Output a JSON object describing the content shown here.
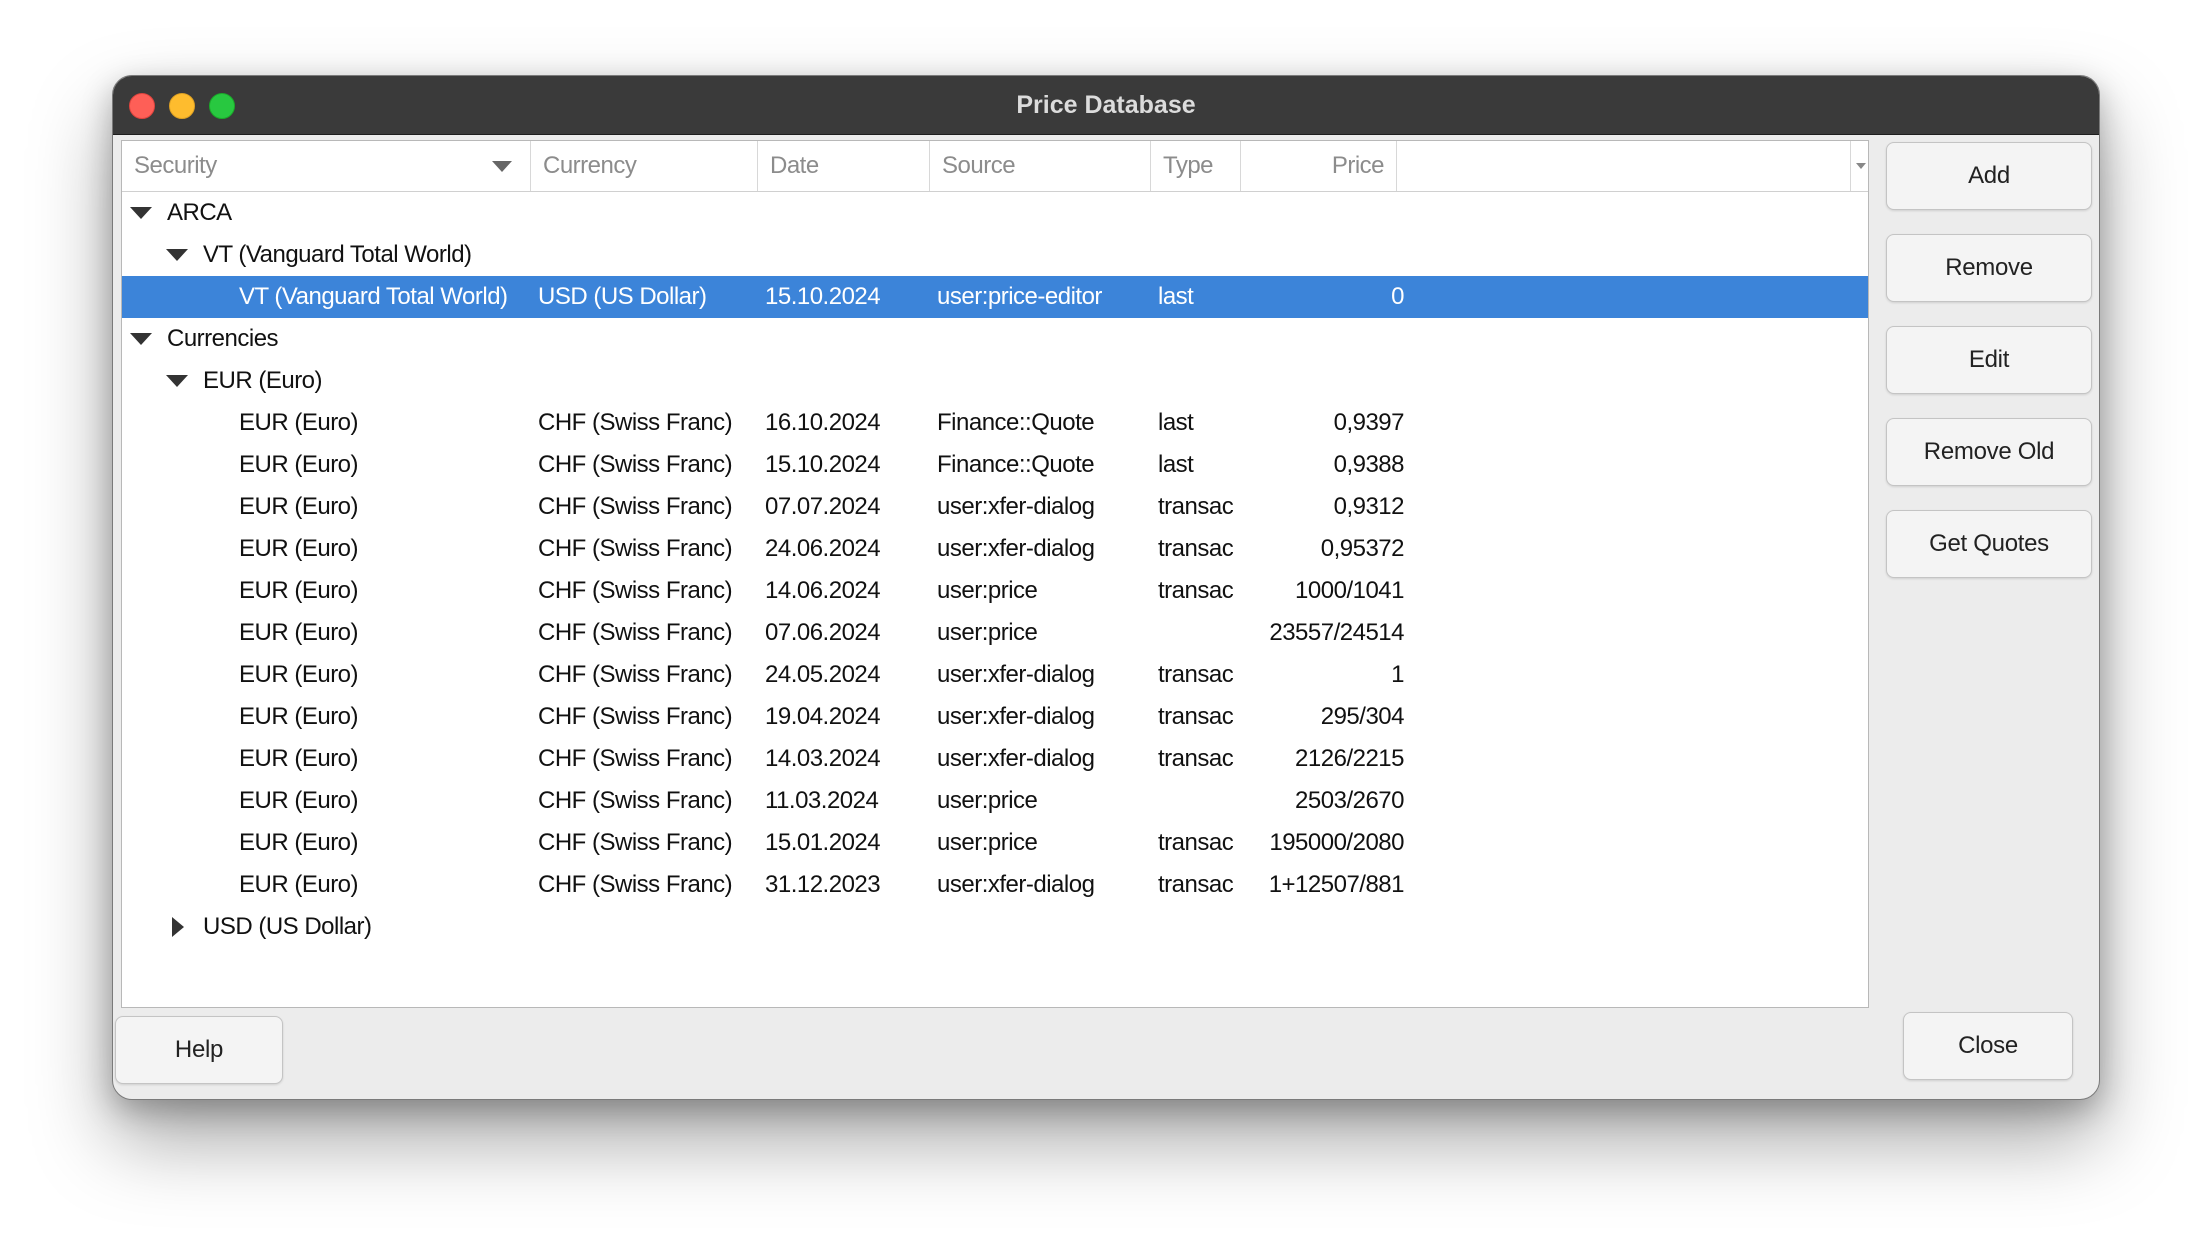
{
  "window": {
    "title": "Price Database"
  },
  "columns": {
    "security": "Security",
    "currency": "Currency",
    "date": "Date",
    "source": "Source",
    "type": "Type",
    "price": "Price"
  },
  "rows": [
    {
      "kind": "group",
      "level": 0,
      "expanded": true,
      "security": "ARCA"
    },
    {
      "kind": "group",
      "level": 1,
      "expanded": true,
      "security": "VT (Vanguard Total World)"
    },
    {
      "kind": "item",
      "level": 2,
      "selected": true,
      "security": "VT (Vanguard Total World)",
      "currency": "USD (US Dollar)",
      "date": "15.10.2024",
      "source": "user:price-editor",
      "type": "last",
      "price": "0"
    },
    {
      "kind": "group",
      "level": 0,
      "expanded": true,
      "security": "Currencies"
    },
    {
      "kind": "group",
      "level": 1,
      "expanded": true,
      "security": "EUR (Euro)"
    },
    {
      "kind": "item",
      "level": 2,
      "security": "EUR (Euro)",
      "currency": "CHF (Swiss Franc)",
      "date": "16.10.2024",
      "source": "Finance::Quote",
      "type": "last",
      "price": "0,9397"
    },
    {
      "kind": "item",
      "level": 2,
      "security": "EUR (Euro)",
      "currency": "CHF (Swiss Franc)",
      "date": "15.10.2024",
      "source": "Finance::Quote",
      "type": "last",
      "price": "0,9388"
    },
    {
      "kind": "item",
      "level": 2,
      "security": "EUR (Euro)",
      "currency": "CHF (Swiss Franc)",
      "date": "07.07.2024",
      "source": "user:xfer-dialog",
      "type": "transac",
      "price": "0,9312"
    },
    {
      "kind": "item",
      "level": 2,
      "security": "EUR (Euro)",
      "currency": "CHF (Swiss Franc)",
      "date": "24.06.2024",
      "source": "user:xfer-dialog",
      "type": "transac",
      "price": "0,95372"
    },
    {
      "kind": "item",
      "level": 2,
      "security": "EUR (Euro)",
      "currency": "CHF (Swiss Franc)",
      "date": "14.06.2024",
      "source": "user:price",
      "type": "transac",
      "price": "1000/1041"
    },
    {
      "kind": "item",
      "level": 2,
      "security": "EUR (Euro)",
      "currency": "CHF (Swiss Franc)",
      "date": "07.06.2024",
      "source": "user:price",
      "type": "",
      "price": "23557/24514"
    },
    {
      "kind": "item",
      "level": 2,
      "security": "EUR (Euro)",
      "currency": "CHF (Swiss Franc)",
      "date": "24.05.2024",
      "source": "user:xfer-dialog",
      "type": "transac",
      "price": "1"
    },
    {
      "kind": "item",
      "level": 2,
      "security": "EUR (Euro)",
      "currency": "CHF (Swiss Franc)",
      "date": "19.04.2024",
      "source": "user:xfer-dialog",
      "type": "transac",
      "price": "295/304"
    },
    {
      "kind": "item",
      "level": 2,
      "security": "EUR (Euro)",
      "currency": "CHF (Swiss Franc)",
      "date": "14.03.2024",
      "source": "user:xfer-dialog",
      "type": "transac",
      "price": "2126/2215"
    },
    {
      "kind": "item",
      "level": 2,
      "security": "EUR (Euro)",
      "currency": "CHF (Swiss Franc)",
      "date": "11.03.2024",
      "source": "user:price",
      "type": "",
      "price": "2503/2670"
    },
    {
      "kind": "item",
      "level": 2,
      "security": "EUR (Euro)",
      "currency": "CHF (Swiss Franc)",
      "date": "15.01.2024",
      "source": "user:price",
      "type": "transac",
      "price": "195000/2080"
    },
    {
      "kind": "item",
      "level": 2,
      "security": "EUR (Euro)",
      "currency": "CHF (Swiss Franc)",
      "date": "31.12.2023",
      "source": "user:xfer-dialog",
      "type": "transac",
      "price": "1+12507/881"
    },
    {
      "kind": "group",
      "level": 1,
      "expanded": false,
      "security": "USD (US Dollar)"
    }
  ],
  "buttons": {
    "add": "Add",
    "remove": "Remove",
    "edit": "Edit",
    "remove_old": "Remove Old",
    "get_quotes": "Get Quotes",
    "help": "Help",
    "close": "Close"
  },
  "colors": {
    "selection": "#3c84d9",
    "titlebar": "#3a3a3a",
    "close_light": "#fe5f57",
    "minimize_light": "#febc2e",
    "zoom_light": "#28c840"
  }
}
